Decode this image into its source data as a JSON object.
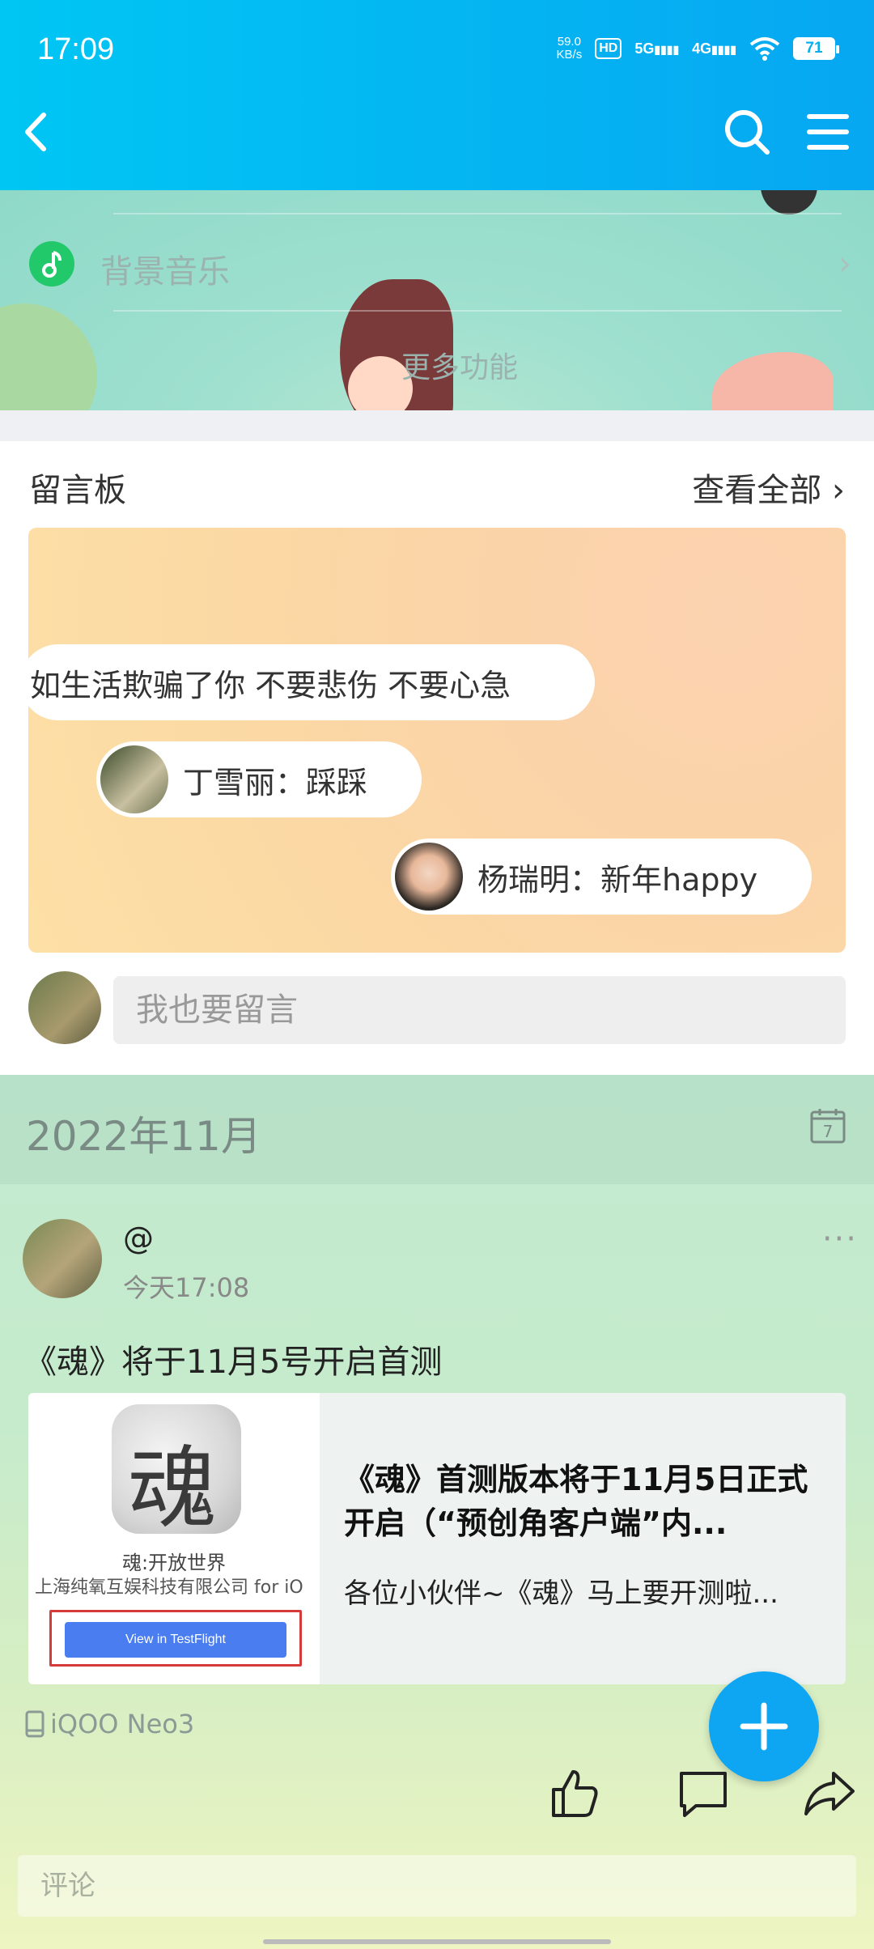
{
  "status_bar": {
    "time": "17:09",
    "net_speed_value": "59.0",
    "net_speed_unit": "KB/s",
    "hd": "HD",
    "sig1": "5G",
    "sig2": "4G",
    "battery": "71"
  },
  "music": {
    "label": "背景音乐",
    "more_label": "更多功能"
  },
  "guestbook": {
    "title": "留言板",
    "view_all": "查看全部",
    "messages": [
      {
        "text": "如生活欺骗了你 不要悲伤 不要心急"
      },
      {
        "text": "丁雪丽：踩踩"
      },
      {
        "text": "杨瑞明：新年happy"
      }
    ],
    "input_placeholder": "我也要留言"
  },
  "feed": {
    "month": "2022年11月",
    "calendar_day": "7",
    "post": {
      "author": "@",
      "time": "今天17:08",
      "text": "《魂》将于11月5号开启首测",
      "link": {
        "thumb_glyph": "魂",
        "app_name": "魂:开放世界",
        "company": "上海纯氧互娱科技有限公司 for iO",
        "button": "View in TestFlight",
        "title": "《魂》首测版本将于11月5日正式开启（“预创角客户端”内...",
        "desc": "各位小伙伴~《魂》马上要开测啦..."
      },
      "device": "iQOO Neo3"
    },
    "comment_placeholder": "评论"
  },
  "colors": {
    "header": "#07a7f2",
    "fab": "#0ea5f3",
    "music_green": "#22c96b",
    "testflight_blue": "#4a7df0"
  }
}
